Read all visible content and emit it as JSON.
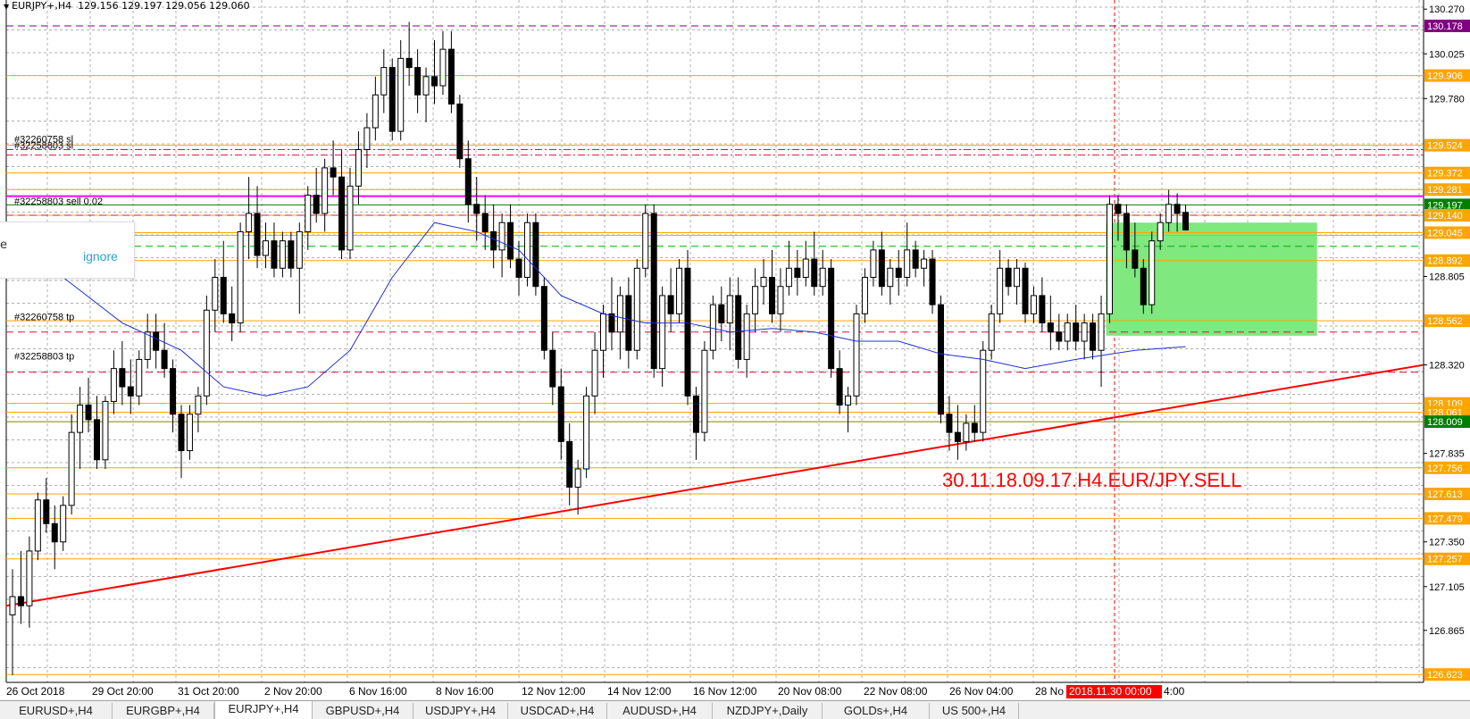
{
  "header": {
    "symbol": "EURJPY+,H4",
    "ohlc": "129.156 129.197 129.056 129.060"
  },
  "popup": {
    "edge_char": "e",
    "ignore_label": "ignore"
  },
  "price_axis": {
    "ticks": [
      {
        "label": "130.270",
        "value": 130.27
      },
      {
        "label": "130.025",
        "value": 130.025
      },
      {
        "label": "129.780",
        "value": 129.78
      },
      {
        "label": "128.805",
        "value": 128.805
      },
      {
        "label": "128.320",
        "value": 128.32
      },
      {
        "label": "127.835",
        "value": 127.835
      },
      {
        "label": "127.350",
        "value": 127.35
      },
      {
        "label": "127.105",
        "value": 127.105
      },
      {
        "label": "126.865",
        "value": 126.865
      }
    ],
    "tags": [
      {
        "label": "130.178",
        "value": 130.178,
        "bg": "#800080",
        "fg": "#ffffff"
      },
      {
        "label": "129.906",
        "value": 129.906,
        "bg": "#ffa500",
        "fg": "#ffffff"
      },
      {
        "label": "129.524",
        "value": 129.524,
        "bg": "#ffa500",
        "fg": "#ffffff"
      },
      {
        "label": "129.372",
        "value": 129.372,
        "bg": "#ffa500",
        "fg": "#ffffff"
      },
      {
        "label": "129.281",
        "value": 129.281,
        "bg": "#ffa500",
        "fg": "#ffffff"
      },
      {
        "label": "129.197",
        "value": 129.197,
        "bg": "#008000",
        "fg": "#ffffff"
      },
      {
        "label": "129.140",
        "value": 129.14,
        "bg": "#ffa500",
        "fg": "#ffffff"
      },
      {
        "label": "129.045",
        "value": 129.045,
        "bg": "#ffa500",
        "fg": "#ffffff"
      },
      {
        "label": "128.892",
        "value": 128.892,
        "bg": "#ffa500",
        "fg": "#ffffff"
      },
      {
        "label": "128.562",
        "value": 128.562,
        "bg": "#ffa500",
        "fg": "#ffffff"
      },
      {
        "label": "128.109",
        "value": 128.109,
        "bg": "#ffa500",
        "fg": "#ffffff"
      },
      {
        "label": "128.061",
        "value": 128.061,
        "bg": "#ffa500",
        "fg": "#ffffff"
      },
      {
        "label": "128.009",
        "value": 128.009,
        "bg": "#008000",
        "fg": "#ffffff"
      },
      {
        "label": "127.756",
        "value": 127.756,
        "bg": "#ffa500",
        "fg": "#ffffff"
      },
      {
        "label": "127.613",
        "value": 127.613,
        "bg": "#ffa500",
        "fg": "#ffffff"
      },
      {
        "label": "127.479",
        "value": 127.479,
        "bg": "#ffa500",
        "fg": "#ffffff"
      },
      {
        "label": "127.257",
        "value": 127.257,
        "bg": "#ffa500",
        "fg": "#ffffff"
      },
      {
        "label": "126.623",
        "value": 126.623,
        "bg": "#ffa500",
        "fg": "#ffffff"
      }
    ]
  },
  "hlines": [
    {
      "value": 130.178,
      "color": "#800080",
      "style": "dash"
    },
    {
      "value": 129.906,
      "color": "#ffa500",
      "style": "solid"
    },
    {
      "value": 129.524,
      "color": "#ffa500",
      "style": "solid"
    },
    {
      "value": 129.5,
      "color": "#dc143c",
      "style": "dashdot"
    },
    {
      "value": 129.47,
      "color": "#dc143c",
      "style": "dashdot"
    },
    {
      "value": 129.372,
      "color": "#ffa500",
      "style": "solid"
    },
    {
      "value": 129.281,
      "color": "#ffa500",
      "style": "solid"
    },
    {
      "value": 129.245,
      "color": "#ff00ff",
      "style": "solid"
    },
    {
      "value": 129.197,
      "color": "#008000",
      "style": "solid"
    },
    {
      "value": 129.14,
      "color": "#ffa500",
      "style": "solid"
    },
    {
      "value": 129.14,
      "color": "#dc143c",
      "style": "dash"
    },
    {
      "value": 129.045,
      "color": "#ffa500",
      "style": "solid"
    },
    {
      "value": 129.03,
      "color": "#ffa500",
      "style": "solid"
    },
    {
      "value": 128.97,
      "color": "#00b000",
      "style": "dash"
    },
    {
      "value": 128.892,
      "color": "#ffa500",
      "style": "solid"
    },
    {
      "value": 128.562,
      "color": "#ffa500",
      "style": "solid"
    },
    {
      "value": 128.5,
      "color": "#dc143c",
      "style": "dash"
    },
    {
      "value": 128.28,
      "color": "#dc143c",
      "style": "dash"
    },
    {
      "value": 128.109,
      "color": "#ffa500",
      "style": "solid"
    },
    {
      "value": 128.061,
      "color": "#ffa500",
      "style": "solid"
    },
    {
      "value": 128.009,
      "color": "#808000",
      "style": "solid"
    },
    {
      "value": 127.756,
      "color": "#ffa500",
      "style": "solid"
    },
    {
      "value": 127.613,
      "color": "#ffa500",
      "style": "solid"
    },
    {
      "value": 127.479,
      "color": "#ffa500",
      "style": "solid"
    },
    {
      "value": 127.257,
      "color": "#ffa500",
      "style": "solid"
    },
    {
      "value": 126.623,
      "color": "#ffa500",
      "style": "solid"
    }
  ],
  "order_labels": [
    {
      "text": "#32260758 sl",
      "value": 129.524
    },
    {
      "text": "#32258803 sl",
      "value": 129.49
    },
    {
      "text": "#32258803 sell 0.02",
      "value": 129.185
    },
    {
      "text": "#32260758 tp",
      "value": 128.55
    },
    {
      "text": "#32258803 tp",
      "value": 128.335
    }
  ],
  "time_axis": {
    "labels": [
      "26 Oct 2018",
      "29 Oct 20:00",
      "31 Oct 20:00",
      "2 Nov 20:00",
      "6 Nov 16:00",
      "8 Nov 16:00",
      "12 Nov 12:00",
      "14 Nov 12:00",
      "16 Nov 12:00",
      "20 Nov 08:00",
      "22 Nov 08:00",
      "26 Nov 04:00",
      "28 No"
    ],
    "highlight": "2018.11.30 00:00",
    "after_highlight": "4:00"
  },
  "annotation": {
    "text": "30.11.18.09.17.H4.EUR/JPY.SELL"
  },
  "tabs": [
    {
      "label": "EURUSD+,H4",
      "active": false
    },
    {
      "label": "EURGBP+,H4",
      "active": false
    },
    {
      "label": "EURJPY+,H4",
      "active": true
    },
    {
      "label": "GBPUSD+,H4",
      "active": false
    },
    {
      "label": "USDJPY+,H4",
      "active": false
    },
    {
      "label": "USDCAD+,H4",
      "active": false
    },
    {
      "label": "AUDUSD+,H4",
      "active": false
    },
    {
      "label": "NZDJPY+,Daily",
      "active": false
    },
    {
      "label": "GOLDs+,H4",
      "active": false
    },
    {
      "label": "US 500+,H4",
      "active": false
    }
  ],
  "colors": {
    "bull_candle": "#ffffff",
    "bear_candle": "#000000",
    "grid": "#b0b0b0",
    "ma": "#1e2fd6",
    "trend": "#ff0000",
    "zone": "#7fe87f",
    "annotation": "#ff0000",
    "time_highlight": "#ff0000"
  },
  "chart_data": {
    "type": "candlestick",
    "symbol": "EURJPY+,H4",
    "ylim": [
      126.58,
      130.32
    ],
    "candles": [
      [
        126.95,
        127.2,
        126.62,
        127.05
      ],
      [
        127.05,
        127.3,
        126.9,
        127.0
      ],
      [
        127.0,
        127.38,
        126.88,
        127.3
      ],
      [
        127.3,
        127.62,
        127.25,
        127.58
      ],
      [
        127.58,
        127.7,
        127.4,
        127.45
      ],
      [
        127.45,
        127.55,
        127.2,
        127.35
      ],
      [
        127.35,
        127.6,
        127.3,
        127.55
      ],
      [
        127.55,
        128.05,
        127.5,
        127.95
      ],
      [
        127.95,
        128.2,
        127.75,
        128.1
      ],
      [
        128.1,
        128.25,
        127.95,
        128.02
      ],
      [
        128.02,
        128.15,
        127.75,
        127.8
      ],
      [
        127.8,
        128.15,
        127.75,
        128.12
      ],
      [
        128.12,
        128.4,
        128.05,
        128.3
      ],
      [
        128.3,
        128.45,
        128.1,
        128.2
      ],
      [
        128.2,
        128.35,
        128.05,
        128.15
      ],
      [
        128.15,
        128.4,
        128.1,
        128.35
      ],
      [
        128.35,
        128.6,
        128.3,
        128.5
      ],
      [
        128.5,
        128.6,
        128.3,
        128.4
      ],
      [
        128.4,
        128.55,
        128.25,
        128.3
      ],
      [
        128.3,
        128.35,
        127.95,
        128.05
      ],
      [
        128.05,
        128.1,
        127.7,
        127.85
      ],
      [
        127.85,
        128.1,
        127.8,
        128.05
      ],
      [
        128.05,
        128.2,
        127.95,
        128.15
      ],
      [
        128.15,
        128.7,
        128.1,
        128.62
      ],
      [
        128.62,
        128.9,
        128.5,
        128.8
      ],
      [
        128.8,
        129.0,
        128.55,
        128.6
      ],
      [
        128.6,
        128.75,
        128.45,
        128.55
      ],
      [
        128.55,
        129.1,
        128.5,
        129.05
      ],
      [
        129.05,
        129.35,
        128.9,
        129.15
      ],
      [
        129.15,
        129.3,
        128.85,
        128.92
      ],
      [
        128.92,
        129.1,
        128.85,
        129.0
      ],
      [
        129.0,
        129.1,
        128.8,
        128.85
      ],
      [
        128.85,
        129.05,
        128.8,
        129.0
      ],
      [
        129.0,
        129.05,
        128.8,
        128.85
      ],
      [
        128.85,
        129.1,
        128.6,
        129.05
      ],
      [
        129.05,
        129.3,
        128.95,
        129.25
      ],
      [
        129.25,
        129.4,
        129.1,
        129.15
      ],
      [
        129.15,
        129.45,
        129.05,
        129.4
      ],
      [
        129.4,
        129.55,
        129.25,
        129.35
      ],
      [
        129.35,
        129.5,
        128.9,
        128.95
      ],
      [
        128.95,
        129.4,
        128.9,
        129.3
      ],
      [
        129.3,
        129.6,
        129.2,
        129.5
      ],
      [
        129.5,
        129.7,
        129.4,
        129.62
      ],
      [
        129.62,
        129.9,
        129.55,
        129.8
      ],
      [
        129.8,
        130.05,
        129.7,
        129.95
      ],
      [
        129.95,
        130.0,
        129.55,
        129.6
      ],
      [
        129.6,
        130.1,
        129.55,
        130.0
      ],
      [
        130.0,
        130.2,
        129.85,
        129.95
      ],
      [
        129.95,
        130.05,
        129.7,
        129.8
      ],
      [
        129.8,
        129.95,
        129.65,
        129.9
      ],
      [
        129.9,
        130.1,
        129.75,
        129.85
      ],
      [
        129.85,
        130.15,
        129.8,
        130.05
      ],
      [
        130.05,
        130.15,
        129.7,
        129.75
      ],
      [
        129.75,
        129.8,
        129.4,
        129.45
      ],
      [
        129.45,
        129.55,
        129.1,
        129.2
      ],
      [
        129.2,
        129.35,
        129.0,
        129.15
      ],
      [
        129.15,
        129.25,
        128.95,
        129.05
      ],
      [
        129.05,
        129.2,
        128.85,
        128.95
      ],
      [
        128.95,
        129.15,
        128.8,
        129.1
      ],
      [
        129.1,
        129.2,
        128.85,
        128.9
      ],
      [
        128.9,
        129.0,
        128.7,
        128.8
      ],
      [
        128.8,
        129.15,
        128.75,
        129.1
      ],
      [
        129.1,
        129.15,
        128.7,
        128.75
      ],
      [
        128.75,
        128.8,
        128.35,
        128.4
      ],
      [
        128.4,
        128.5,
        128.1,
        128.2
      ],
      [
        128.2,
        128.3,
        127.8,
        127.9
      ],
      [
        127.9,
        128.0,
        127.55,
        127.65
      ],
      [
        127.65,
        127.8,
        127.5,
        127.75
      ],
      [
        127.75,
        128.2,
        127.7,
        128.15
      ],
      [
        128.15,
        128.5,
        128.05,
        128.4
      ],
      [
        128.4,
        128.65,
        128.25,
        128.6
      ],
      [
        128.6,
        128.8,
        128.4,
        128.5
      ],
      [
        128.5,
        128.75,
        128.35,
        128.7
      ],
      [
        128.7,
        128.8,
        128.3,
        128.4
      ],
      [
        128.4,
        128.9,
        128.35,
        128.85
      ],
      [
        128.85,
        129.2,
        128.8,
        129.15
      ],
      [
        129.15,
        129.2,
        128.25,
        128.3
      ],
      [
        128.3,
        128.75,
        128.2,
        128.7
      ],
      [
        128.7,
        128.85,
        128.5,
        128.6
      ],
      [
        128.6,
        128.9,
        128.55,
        128.85
      ],
      [
        128.85,
        128.95,
        128.1,
        128.15
      ],
      [
        128.15,
        128.2,
        127.8,
        127.95
      ],
      [
        127.95,
        128.45,
        127.9,
        128.4
      ],
      [
        128.4,
        128.7,
        128.35,
        128.65
      ],
      [
        128.65,
        128.75,
        128.45,
        128.55
      ],
      [
        128.55,
        128.8,
        128.4,
        128.7
      ],
      [
        128.7,
        128.8,
        128.3,
        128.35
      ],
      [
        128.35,
        128.65,
        128.25,
        128.6
      ],
      [
        128.6,
        128.85,
        128.5,
        128.75
      ],
      [
        128.75,
        128.9,
        128.65,
        128.8
      ],
      [
        128.8,
        128.95,
        128.55,
        128.6
      ],
      [
        128.6,
        128.85,
        128.5,
        128.75
      ],
      [
        128.75,
        129.0,
        128.7,
        128.85
      ],
      [
        128.85,
        128.95,
        128.7,
        128.8
      ],
      [
        128.8,
        129.0,
        128.75,
        128.9
      ],
      [
        128.9,
        129.05,
        128.7,
        128.75
      ],
      [
        128.75,
        128.95,
        128.7,
        128.85
      ],
      [
        128.85,
        128.9,
        128.25,
        128.3
      ],
      [
        128.3,
        128.4,
        128.05,
        128.1
      ],
      [
        128.1,
        128.2,
        127.95,
        128.15
      ],
      [
        128.15,
        128.65,
        128.1,
        128.6
      ],
      [
        128.6,
        128.85,
        128.55,
        128.8
      ],
      [
        128.8,
        129.0,
        128.75,
        128.95
      ],
      [
        128.95,
        129.05,
        128.7,
        128.75
      ],
      [
        128.75,
        128.9,
        128.65,
        128.85
      ],
      [
        128.85,
        128.95,
        128.7,
        128.8
      ],
      [
        128.8,
        129.1,
        128.75,
        128.95
      ],
      [
        128.95,
        129.0,
        128.8,
        128.85
      ],
      [
        128.85,
        128.95,
        128.75,
        128.9
      ],
      [
        128.9,
        128.95,
        128.6,
        128.65
      ],
      [
        128.65,
        128.7,
        128.0,
        128.05
      ],
      [
        128.05,
        128.15,
        127.85,
        127.95
      ],
      [
        127.95,
        128.1,
        127.8,
        127.9
      ],
      [
        127.9,
        128.05,
        127.85,
        128.0
      ],
      [
        128.0,
        128.1,
        127.9,
        127.95
      ],
      [
        127.95,
        128.45,
        127.9,
        128.4
      ],
      [
        128.4,
        128.65,
        128.35,
        128.6
      ],
      [
        128.6,
        128.95,
        128.55,
        128.85
      ],
      [
        128.85,
        128.9,
        128.7,
        128.75
      ],
      [
        128.75,
        128.9,
        128.65,
        128.85
      ],
      [
        128.85,
        128.88,
        128.55,
        128.6
      ],
      [
        128.6,
        128.75,
        128.55,
        128.7
      ],
      [
        128.7,
        128.8,
        128.5,
        128.55
      ],
      [
        128.55,
        128.7,
        128.4,
        128.5
      ],
      [
        128.5,
        128.6,
        128.4,
        128.45
      ],
      [
        128.45,
        128.6,
        128.4,
        128.55
      ],
      [
        128.55,
        128.65,
        128.4,
        128.45
      ],
      [
        128.45,
        128.6,
        128.35,
        128.55
      ],
      [
        128.55,
        128.6,
        128.35,
        128.4
      ],
      [
        128.4,
        128.7,
        128.2,
        128.6
      ],
      [
        128.6,
        129.25,
        128.55,
        129.2
      ],
      [
        129.2,
        129.25,
        129.0,
        129.15
      ],
      [
        129.15,
        129.2,
        128.85,
        128.95
      ],
      [
        128.95,
        129.1,
        128.8,
        128.85
      ],
      [
        128.85,
        128.9,
        128.6,
        128.65
      ],
      [
        128.65,
        129.05,
        128.6,
        129.0
      ],
      [
        129.0,
        129.15,
        128.95,
        129.1
      ],
      [
        129.1,
        129.28,
        129.05,
        129.2
      ],
      [
        129.2,
        129.26,
        129.05,
        129.15
      ],
      [
        129.156,
        129.197,
        129.056,
        129.06
      ]
    ],
    "sma": [
      [
        0,
        129.0
      ],
      [
        6,
        128.8
      ],
      [
        13,
        128.55
      ],
      [
        20,
        128.4
      ],
      [
        25,
        128.2
      ],
      [
        30,
        128.15
      ],
      [
        35,
        128.2
      ],
      [
        40,
        128.4
      ],
      [
        45,
        128.8
      ],
      [
        50,
        129.1
      ],
      [
        55,
        129.05
      ],
      [
        60,
        128.95
      ],
      [
        65,
        128.7
      ],
      [
        70,
        128.6
      ],
      [
        75,
        128.55
      ],
      [
        80,
        128.55
      ],
      [
        85,
        128.5
      ],
      [
        90,
        128.52
      ],
      [
        95,
        128.5
      ],
      [
        100,
        128.45
      ],
      [
        105,
        128.45
      ],
      [
        110,
        128.38
      ],
      [
        115,
        128.35
      ],
      [
        120,
        128.3
      ],
      [
        126,
        128.35
      ],
      [
        133,
        128.4
      ],
      [
        139,
        128.42
      ]
    ],
    "trendline": [
      [
        127.0
      ],
      [
        128.32
      ]
    ],
    "sell_zone": {
      "from_bar": 130,
      "to_bar": 155,
      "top": 129.1,
      "bottom": 128.48
    }
  }
}
